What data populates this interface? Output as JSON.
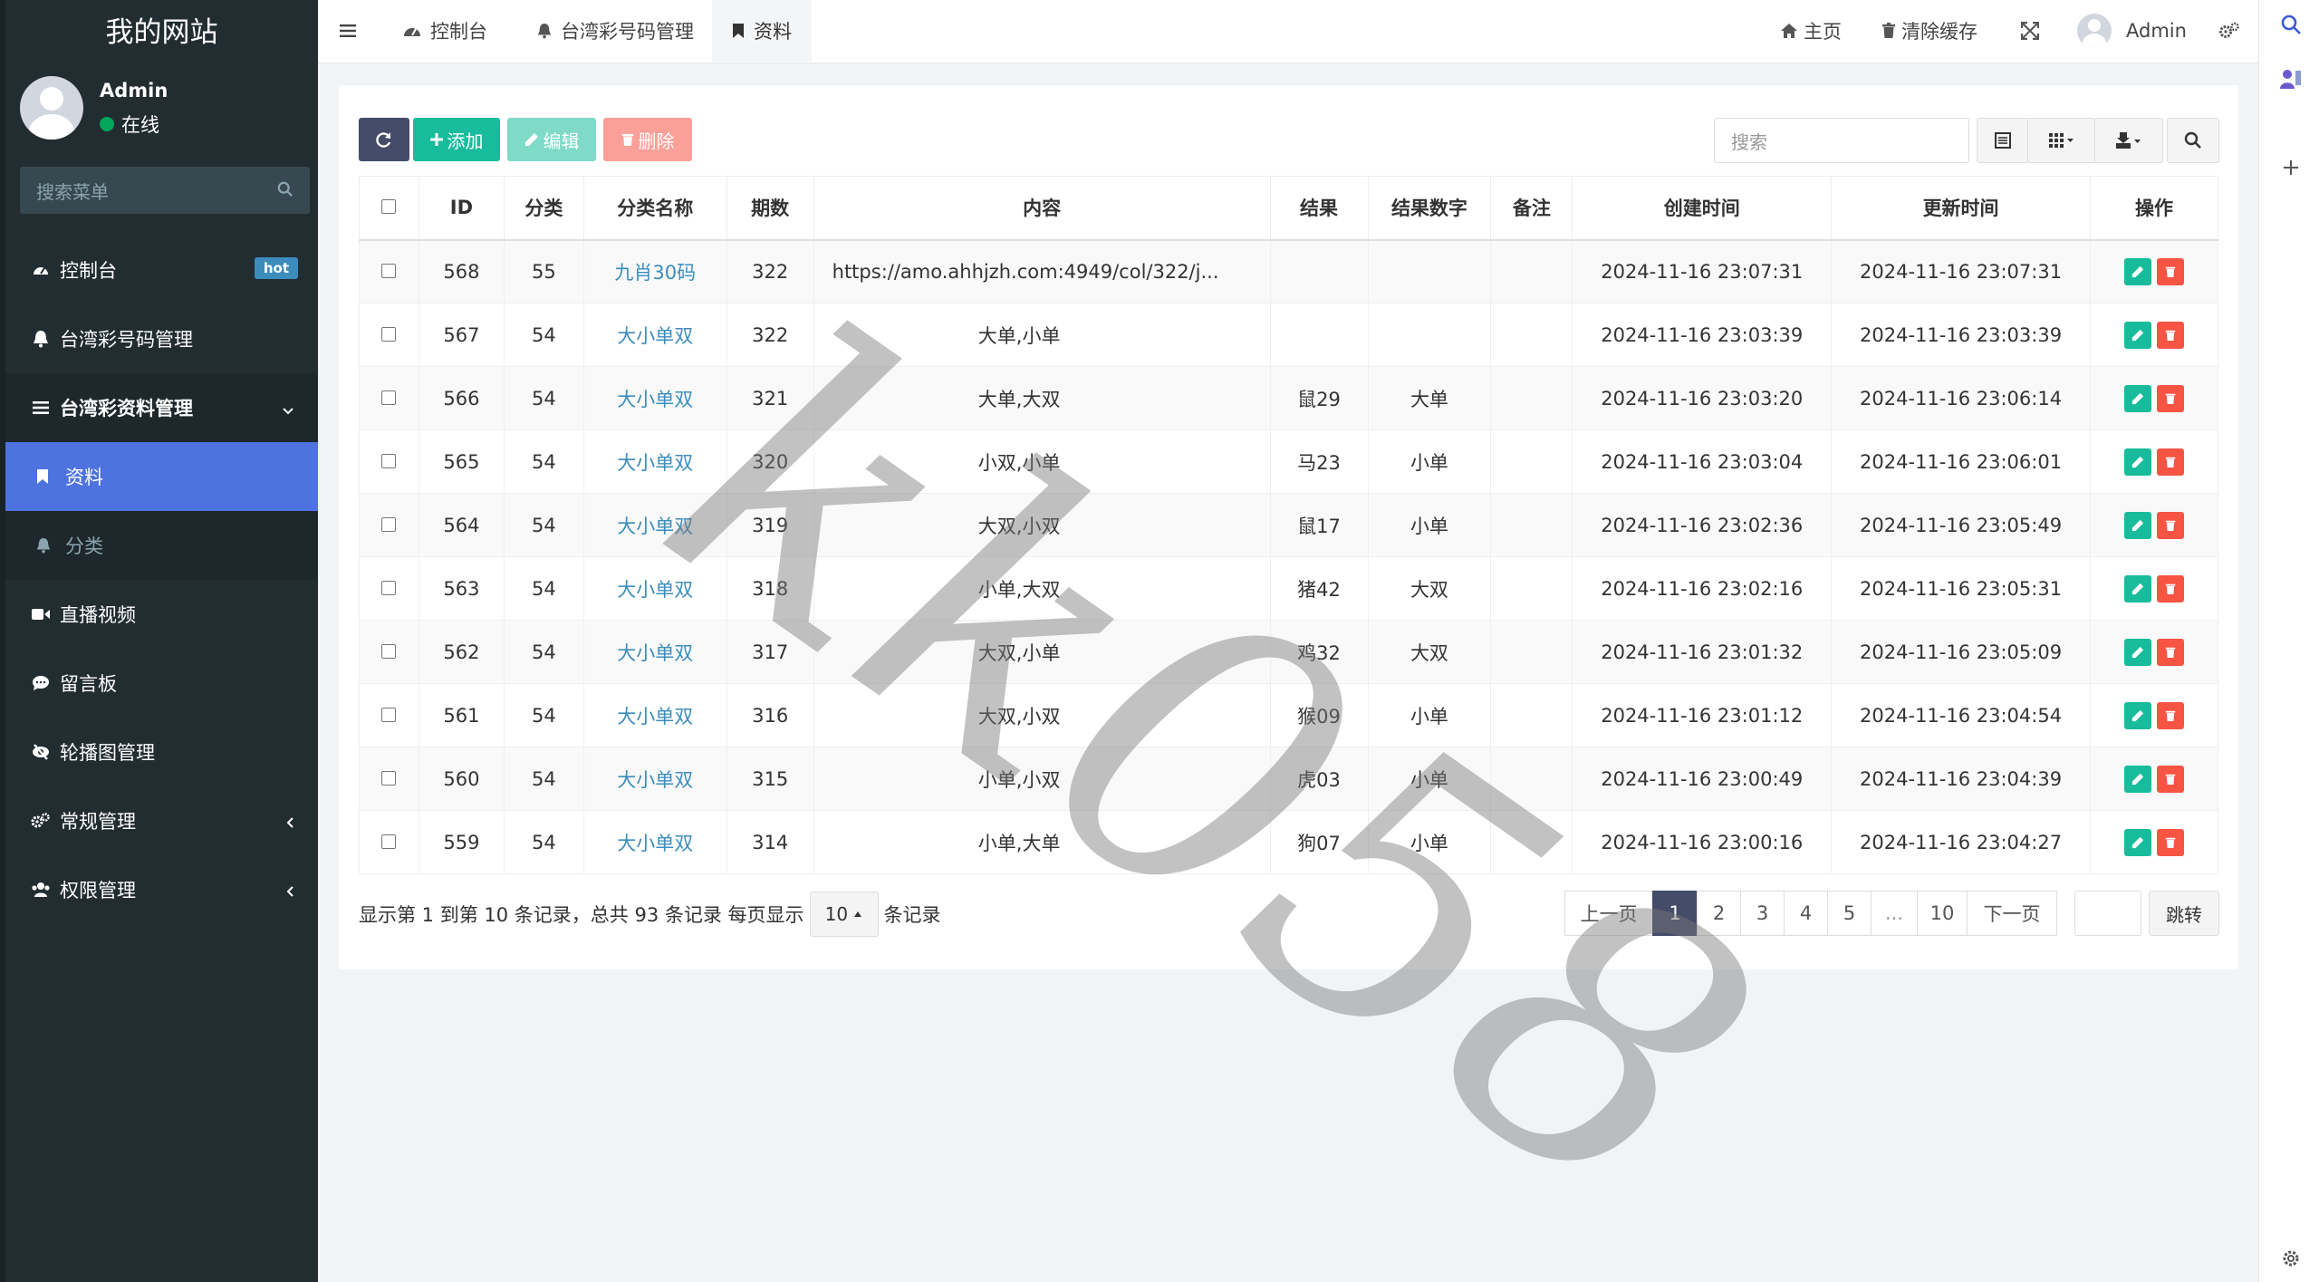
{
  "brand": "我的网站",
  "user": {
    "name": "Admin",
    "status": "在线"
  },
  "sidebar": {
    "search_placeholder": "搜索菜单",
    "items": [
      {
        "label": "控制台",
        "badge": "hot"
      },
      {
        "label": "台湾彩号码管理"
      },
      {
        "label": "台湾彩资料管理"
      },
      {
        "label": "直播视频"
      },
      {
        "label": "留言板"
      },
      {
        "label": "轮播图管理"
      },
      {
        "label": "常规管理"
      },
      {
        "label": "权限管理"
      }
    ],
    "sub_items": [
      {
        "label": "资料"
      },
      {
        "label": "分类"
      }
    ]
  },
  "topbar": {
    "tabs": [
      "控制台",
      "台湾彩号码管理",
      "资料"
    ],
    "home": "主页",
    "clear_cache": "清除缓存",
    "admin": "Admin"
  },
  "toolbar": {
    "add": "添加",
    "edit": "编辑",
    "delete": "删除",
    "search_placeholder": "搜索"
  },
  "table": {
    "headers": [
      "ID",
      "分类",
      "分类名称",
      "期数",
      "内容",
      "结果",
      "结果数字",
      "备注",
      "创建时间",
      "更新时间",
      "操作"
    ],
    "rows": [
      {
        "id": "568",
        "cat": "55",
        "cat_name": "九肖30码",
        "period": "322",
        "content": "https://amo.ahhjzh.com:4949/col/322/j...",
        "result": "",
        "result_num": "",
        "note": "",
        "created": "2024-11-16 23:07:31",
        "updated": "2024-11-16 23:07:31"
      },
      {
        "id": "567",
        "cat": "54",
        "cat_name": "大小单双",
        "period": "322",
        "content": "大单,小单",
        "result": "",
        "result_num": "",
        "note": "",
        "created": "2024-11-16 23:03:39",
        "updated": "2024-11-16 23:03:39"
      },
      {
        "id": "566",
        "cat": "54",
        "cat_name": "大小单双",
        "period": "321",
        "content": "大单,大双",
        "result": "鼠29",
        "result_num": "大单",
        "note": "",
        "created": "2024-11-16 23:03:20",
        "updated": "2024-11-16 23:06:14"
      },
      {
        "id": "565",
        "cat": "54",
        "cat_name": "大小单双",
        "period": "320",
        "content": "小双,小单",
        "result": "马23",
        "result_num": "小单",
        "note": "",
        "created": "2024-11-16 23:03:04",
        "updated": "2024-11-16 23:06:01"
      },
      {
        "id": "564",
        "cat": "54",
        "cat_name": "大小单双",
        "period": "319",
        "content": "大双,小双",
        "result": "鼠17",
        "result_num": "小单",
        "note": "",
        "created": "2024-11-16 23:02:36",
        "updated": "2024-11-16 23:05:49"
      },
      {
        "id": "563",
        "cat": "54",
        "cat_name": "大小单双",
        "period": "318",
        "content": "小单,大双",
        "result": "猪42",
        "result_num": "大双",
        "note": "",
        "created": "2024-11-16 23:02:16",
        "updated": "2024-11-16 23:05:31"
      },
      {
        "id": "562",
        "cat": "54",
        "cat_name": "大小单双",
        "period": "317",
        "content": "大双,小单",
        "result": "鸡32",
        "result_num": "大双",
        "note": "",
        "created": "2024-11-16 23:01:32",
        "updated": "2024-11-16 23:05:09"
      },
      {
        "id": "561",
        "cat": "54",
        "cat_name": "大小单双",
        "period": "316",
        "content": "大双,小双",
        "result": "猴09",
        "result_num": "小单",
        "note": "",
        "created": "2024-11-16 23:01:12",
        "updated": "2024-11-16 23:04:54"
      },
      {
        "id": "560",
        "cat": "54",
        "cat_name": "大小单双",
        "period": "315",
        "content": "小单,小双",
        "result": "虎03",
        "result_num": "小单",
        "note": "",
        "created": "2024-11-16 23:00:49",
        "updated": "2024-11-16 23:04:39"
      },
      {
        "id": "559",
        "cat": "54",
        "cat_name": "大小单双",
        "period": "314",
        "content": "小单,大单",
        "result": "狗07",
        "result_num": "小单",
        "note": "",
        "created": "2024-11-16 23:00:16",
        "updated": "2024-11-16 23:04:27"
      }
    ]
  },
  "footer": {
    "info": "显示第 1 到第 10 条记录，总共 93 条记录 每页显示",
    "page_size": "10",
    "suffix": "条记录",
    "prev": "上一页",
    "pages": [
      "1",
      "2",
      "3",
      "4",
      "5",
      "...",
      "10"
    ],
    "next": "下一页",
    "jump": "跳转"
  },
  "watermark": "kk058",
  "colors": {
    "sidebar_bg": "#222d32",
    "active_menu": "#4e73df",
    "success": "#18bc9c",
    "danger": "#f75444",
    "primary_dark": "#444c69",
    "link": "#3c8dbc"
  }
}
